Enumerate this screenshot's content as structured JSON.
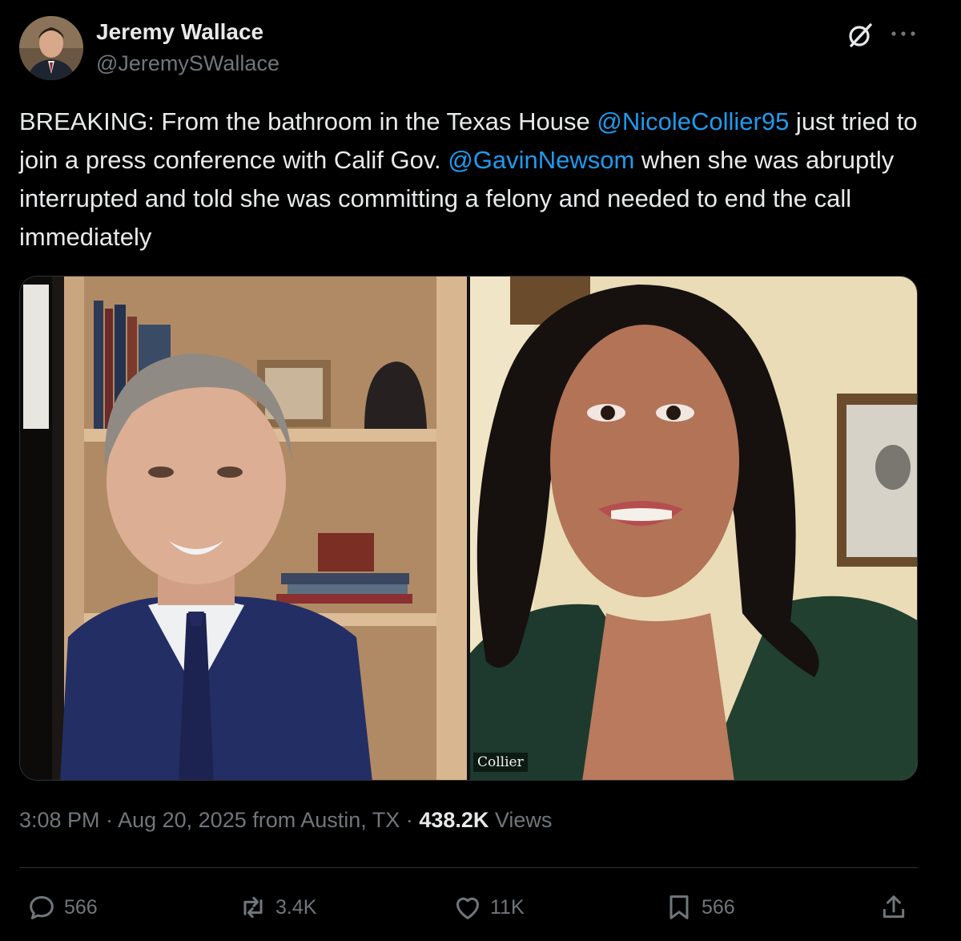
{
  "author": {
    "name": "Jeremy Wallace",
    "handle": "@JeremySWallace"
  },
  "tweet": {
    "text_1": "BREAKING: From the bathroom in the Texas House ",
    "mention_1": "@NicoleCollier95",
    "text_2": " just tried to join a press conference with Calif Gov. ",
    "mention_2": "@GavinNewsom",
    "text_3": " when she was abruptly interrupted and told she was committing a felony and needed to end the call immediately"
  },
  "media": {
    "right_name_tag": "Collier"
  },
  "meta": {
    "time": "3:08 PM",
    "separator": " · ",
    "date": "Aug 20, 2025",
    "location": " from Austin, TX",
    "views_count": "438.2K",
    "views_label": " Views"
  },
  "actions": {
    "replies": "566",
    "reposts": "3.4K",
    "likes": "11K",
    "bookmarks": "566"
  },
  "colors": {
    "background": "#000000",
    "text": "#e7e9ea",
    "secondary": "#71767b",
    "link": "#1d9bf0"
  },
  "icons": [
    "grok-icon",
    "more-icon",
    "reply-icon",
    "repost-icon",
    "like-icon",
    "bookmark-icon",
    "share-icon"
  ]
}
